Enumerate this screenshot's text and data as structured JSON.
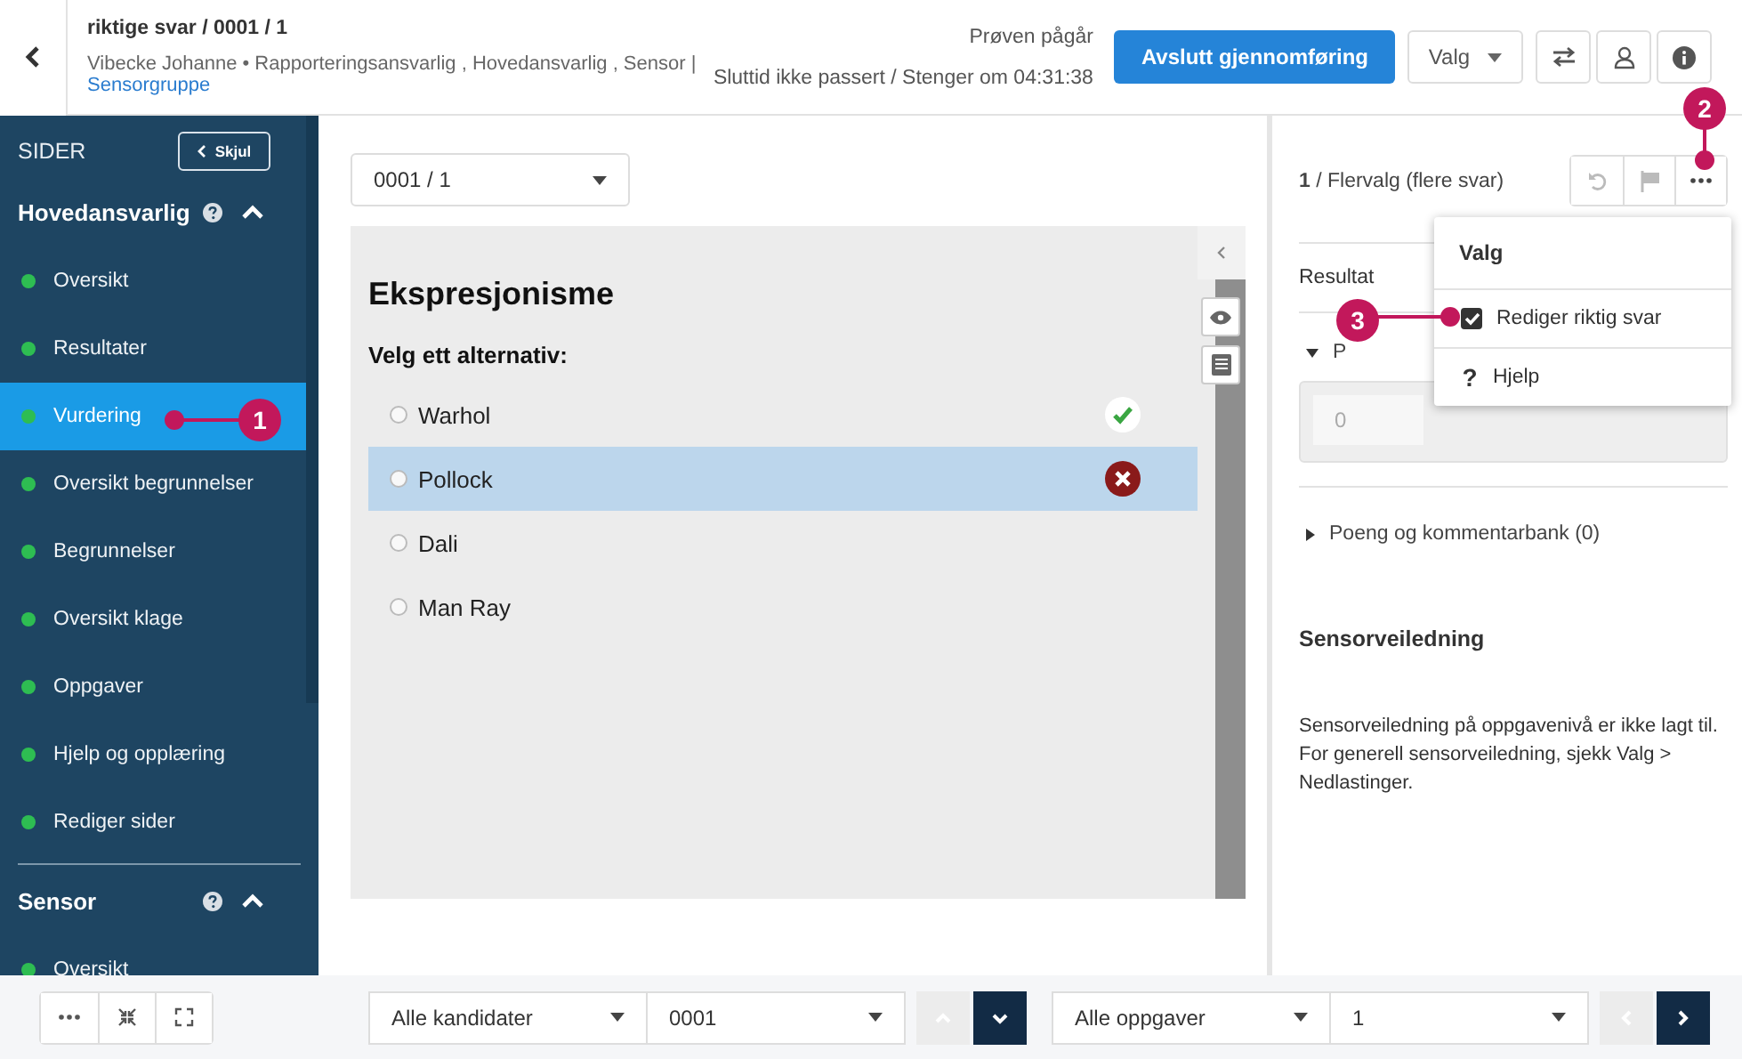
{
  "header": {
    "title": "riktige svar / 0001 / 1",
    "subtitle": "Vibecke Johanne • Rapporteringsansvarlig , Hovedansvarlig , Sensor |",
    "link": "Sensorgruppe",
    "status": "Prøven pågår",
    "deadline": "Sluttid ikke passert / Stenger om 04:31:38",
    "primary_button": "Avslutt gjennomføring",
    "menu_button": "Valg",
    "icon_buttons": [
      {
        "kind": "swap"
      },
      {
        "kind": "user"
      },
      {
        "kind": "info"
      }
    ]
  },
  "sidebar": {
    "title": "SIDER",
    "hide_button": "Skjul",
    "groups": [
      {
        "title": "Hovedansvarlig",
        "expanded": true,
        "items": [
          {
            "label": "Oversikt",
            "selected": false
          },
          {
            "label": "Resultater",
            "selected": false
          },
          {
            "label": "Vurdering",
            "selected": true
          },
          {
            "label": "Oversikt begrunnelser",
            "selected": false
          },
          {
            "label": "Begrunnelser",
            "selected": false
          },
          {
            "label": "Oversikt klage",
            "selected": false
          },
          {
            "label": "Oppgaver",
            "selected": false
          },
          {
            "label": "Hjelp og opplæring",
            "selected": false
          },
          {
            "label": "Rediger sider",
            "selected": false
          }
        ]
      },
      {
        "title": "Sensor",
        "expanded": true,
        "items": [
          {
            "label": "Oversikt",
            "selected": false
          }
        ]
      }
    ]
  },
  "task_select": "0001 / 1",
  "question": {
    "title": "Ekspresjonisme",
    "prompt": "Velg ett alternativ:",
    "options": [
      {
        "label": "Warhol",
        "selected": false,
        "correct": true
      },
      {
        "label": "Pollock",
        "selected": true,
        "correct": false
      },
      {
        "label": "Dali",
        "selected": false
      },
      {
        "label": "Man Ray",
        "selected": false
      }
    ]
  },
  "panel": {
    "heading": "**1** / Flervalg (flere svar)",
    "tools": [
      {
        "kind": "undo"
      },
      {
        "kind": "flag"
      },
      {
        "kind": "more"
      }
    ],
    "result_label": "Resultat",
    "points_label": "P",
    "points_value": "0",
    "bank_label": "Poeng og kommentarbank (0)",
    "guide_title": "Sensorveiledning",
    "guide_text": "Sensorveiledning på oppgavenivå er ikke lagt til. For generell sensorveiledning, sjekk Valg > Nedlastinger."
  },
  "dropdown_menu": {
    "title": "Valg",
    "items": [
      {
        "kind": "checkbox",
        "label": "Rediger riktig svar",
        "checked": true
      },
      {
        "kind": "help",
        "icon": "?",
        "label": "Hjelp"
      }
    ]
  },
  "footer": {
    "view_buttons": [
      {
        "kind": "more"
      },
      {
        "kind": "collapse"
      },
      {
        "kind": "expand"
      }
    ],
    "selectors": [
      {
        "filter": "Alle kandidater",
        "value": "0001",
        "prev_disabled": true,
        "next_disabled": false,
        "kind": "vertical"
      },
      {
        "filter": "Alle oppgaver",
        "value": "1",
        "prev_disabled": true,
        "next_disabled": false,
        "kind": "horizontal"
      }
    ]
  },
  "callouts": [
    {
      "number": "1",
      "kind": "sidebar"
    },
    {
      "number": "2",
      "kind": "more"
    },
    {
      "number": "3",
      "kind": "menu"
    }
  ]
}
